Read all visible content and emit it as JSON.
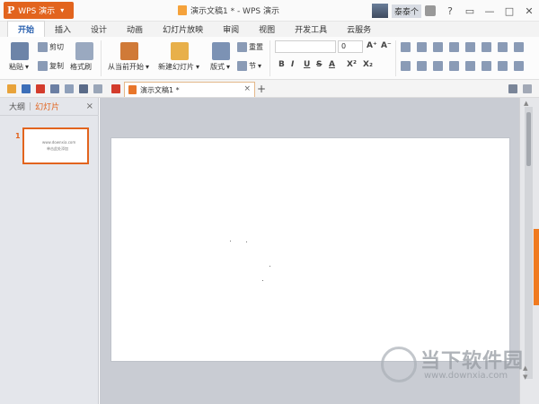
{
  "window": {
    "app_menu_label": "WPS 演示",
    "app_logo": "P",
    "title": "演示文稿1 * - WPS 演示",
    "username": "泰泰个",
    "controls": [
      "?",
      "▭",
      "—",
      "□",
      "✕"
    ]
  },
  "tabs": [
    {
      "label": "开始",
      "active": true
    },
    {
      "label": "插入",
      "active": false
    },
    {
      "label": "设计",
      "active": false
    },
    {
      "label": "动画",
      "active": false
    },
    {
      "label": "幻灯片放映",
      "active": false
    },
    {
      "label": "审阅",
      "active": false
    },
    {
      "label": "视图",
      "active": false
    },
    {
      "label": "开发工具",
      "active": false
    },
    {
      "label": "云服务",
      "active": false
    }
  ],
  "ribbon": {
    "paste": "粘贴",
    "cut": "剪切",
    "copy": "复制",
    "format_painter": "格式刷",
    "from_current": "从当前开始",
    "new_slide": "新建幻灯片",
    "layout": "版式",
    "reset": "重置",
    "section": "节",
    "font_size": "0",
    "bold": "B",
    "italic": "I",
    "underline": "U",
    "strike": "S",
    "font_color": "A",
    "superscript": "X²",
    "subscript": "X₂",
    "grow": "A⁺",
    "shrink": "A⁻"
  },
  "document_tab": {
    "label": "演示文稿1 *",
    "close": "×",
    "add": "+"
  },
  "left_panel": {
    "tab_outline": "大纲",
    "tab_divider": "|",
    "tab_slides": "幻灯片",
    "close": "×",
    "slide_number": "1",
    "thumb_line1": "www.downxia.com",
    "thumb_line2": "单击此处添加"
  },
  "watermark": {
    "text": "当下软件园",
    "url": "www.downxia.com"
  },
  "colors": {
    "accent": "#e2641e",
    "active_tab": "#2b62b0",
    "workspace": "#c9ccd3",
    "panel": "#e4e6eb"
  }
}
